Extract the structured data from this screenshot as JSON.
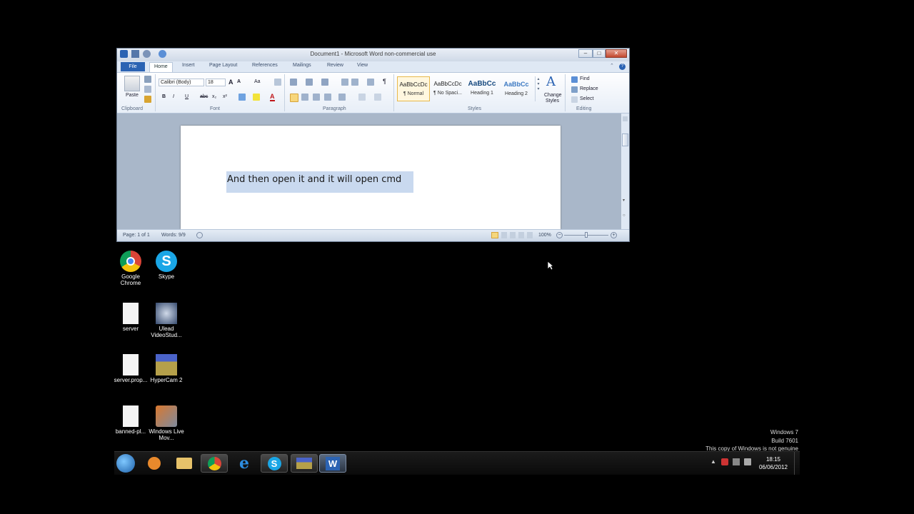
{
  "word": {
    "title": "Document1 - Microsoft Word non-commercial use",
    "tabs": [
      "File",
      "Home",
      "Insert",
      "Page Layout",
      "References",
      "Mailings",
      "Review",
      "View"
    ],
    "clipboard": {
      "paste": "Paste",
      "label": "Clipboard"
    },
    "font": {
      "name": "Calibri (Body)",
      "size": "18",
      "label": "Font",
      "bold": "B",
      "italic": "I",
      "underline": "U",
      "strike": "abc",
      "sub": "x₂",
      "sup": "x²",
      "grow": "A",
      "shrink": "A",
      "case": "Aa",
      "color_a": "A"
    },
    "paragraph": {
      "label": "Paragraph",
      "pilcrow": "¶"
    },
    "styles": {
      "label": "Styles",
      "items": [
        {
          "sample": "AaBbCcDc",
          "name": "¶ Normal"
        },
        {
          "sample": "AaBbCcDc",
          "name": "¶ No Spaci..."
        },
        {
          "sample": "AaBbCc",
          "name": "Heading 1"
        },
        {
          "sample": "AaBbCc",
          "name": "Heading 2"
        }
      ],
      "change_line1": "Change",
      "change_line2": "Styles"
    },
    "editing": {
      "label": "Editing",
      "find": "Find",
      "replace": "Replace",
      "select": "Select"
    },
    "document_text": "And then open it and it will open cmd",
    "status": {
      "page": "Page: 1 of 1",
      "words": "Words: 9/9",
      "zoom": "100%"
    }
  },
  "desktop_icons": [
    {
      "label": "Google Chrome"
    },
    {
      "label": "Skype"
    },
    {
      "label": "server"
    },
    {
      "label": "Ulead VideoStud..."
    },
    {
      "label": "server.prop..."
    },
    {
      "label": "HyperCam 2"
    },
    {
      "label": "banned-pl..."
    },
    {
      "label": "Windows Live Mov..."
    }
  ],
  "watermark": {
    "line1": "Windows 7",
    "line2": "Build 7601",
    "line3": "This copy of Windows is not genuine"
  },
  "clock": {
    "time": "18:15",
    "date": "06/06/2012"
  },
  "colors": {
    "selection": "#c9d9ef",
    "file_tab": "#2b63b3",
    "taskbar": "#0f0f0f"
  }
}
